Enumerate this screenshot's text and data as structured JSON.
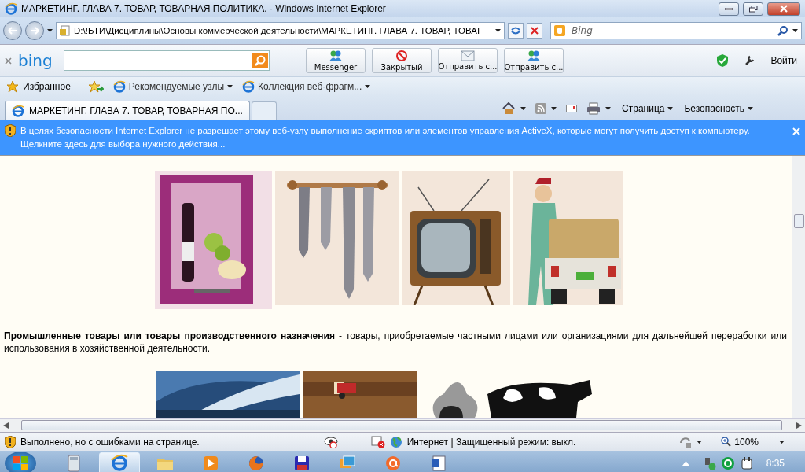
{
  "window": {
    "title": "МАРКЕТИНГ. ГЛАВА 7. ТОВАР, ТОВАРНАЯ ПОЛИТИКА. - Windows Internet Explorer"
  },
  "address_bar": {
    "path": "D:\\!БТИ\\Дисциплины\\Основы коммерческой деятельности\\МАРКЕТИНГ. ГЛАВА 7. ТОВАР, ТОВАI"
  },
  "search": {
    "placeholder": "Bing"
  },
  "bing_bar": {
    "logo": "bing",
    "buttons": [
      {
        "label": "Messenger",
        "kind": "people"
      },
      {
        "label": "Закрытый",
        "kind": "block"
      },
      {
        "label": "Отправить с...",
        "kind": "mail"
      },
      {
        "label": "Отправить с...",
        "kind": "people"
      }
    ],
    "sign_in": "Войти"
  },
  "favorites_bar": {
    "label": "Избранное",
    "links": [
      "Рекомендуемые узлы",
      "Коллекция веб-фрагм..."
    ]
  },
  "tabs": [
    {
      "label": "МАРКЕТИНГ. ГЛАВА 7. ТОВАР, ТОВАРНАЯ ПО...",
      "selected": true
    }
  ],
  "command_bar": {
    "menus": [
      "Страница",
      "Безопасность"
    ]
  },
  "info_bar": {
    "lines": [
      "В целях безопасности Internet Explorer не разрешает этому веб-узлу выполнение скриптов или элементов управления ActiveX, которые могут получить доступ к компьютеру.",
      "Щелкните здесь для выбора нужного действия..."
    ]
  },
  "page": {
    "paragraph": "**Промышленные товары или товары производственного назначения** - товары, приобретаемые частными лицами или организациями для дальнейшей переработки или использования в хозяйственной деятельности."
  },
  "status_bar": {
    "message": "Выполнено, но с ошибками на странице.",
    "zone": "Интернет | Защищенный режим: выкл.",
    "zoom": "100%"
  },
  "taskbar": {
    "apps": [
      {
        "kind": "calculator",
        "selected": false
      },
      {
        "kind": "browser",
        "selected": true
      },
      {
        "kind": "folder",
        "selected": false
      },
      {
        "kind": "player",
        "selected": false
      },
      {
        "kind": "fox",
        "selected": false
      },
      {
        "kind": "disk",
        "selected": false
      },
      {
        "kind": "photos",
        "selected": false
      },
      {
        "kind": "mail",
        "selected": false
      },
      {
        "kind": "document",
        "selected": false
      }
    ],
    "clock": "8:35"
  }
}
